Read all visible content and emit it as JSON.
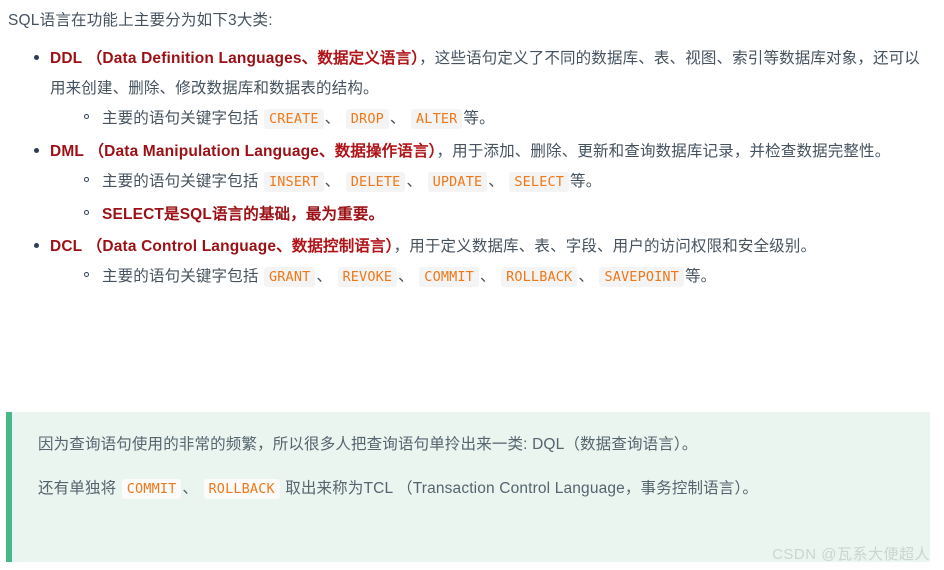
{
  "doc": {
    "intro": "SQL语言在功能上主要分为如下3大类:",
    "sections": [
      {
        "abbr": "DDL",
        "title_en": "（Data Definition Languages、",
        "title_cn": "数据定义语言）",
        "body": "，这些语句定义了不同的数据库、表、视图、索引等数据库对象，还可以用来创建、删除、修改数据库和数据表的结构。",
        "subitems": [
          {
            "type": "keywords",
            "prefix": "主要的语句关键字包括",
            "keywords": [
              "CREATE",
              "DROP",
              "ALTER"
            ],
            "separator": "、",
            "suffix": "等。"
          }
        ]
      },
      {
        "abbr": "DML",
        "title_en": "（Data Manipulation Language、",
        "title_cn": "数据操作语言）",
        "body": "，用于添加、删除、更新和查询数据库记录，并检查数据完整性。",
        "subitems": [
          {
            "type": "keywords",
            "prefix": "主要的语句关键字包括",
            "keywords": [
              "INSERT",
              "DELETE",
              "UPDATE",
              "SELECT"
            ],
            "separator": "、",
            "suffix": "等。"
          },
          {
            "type": "bold",
            "text": "SELECT是SQL语言的基础，最为重要。"
          }
        ]
      },
      {
        "abbr": "DCL",
        "title_en": "（Data Control Language、",
        "title_cn": "数据控制语言）",
        "body": "，用于定义数据库、表、字段、用户的访问权限和安全级别。",
        "subitems": [
          {
            "type": "keywords",
            "prefix": "主要的语句关键字包括",
            "keywords": [
              "GRANT",
              "REVOKE",
              "COMMIT",
              "ROLLBACK",
              "SAVEPOINT"
            ],
            "separator": "、",
            "suffix": "等。"
          }
        ]
      }
    ]
  },
  "callout": {
    "paragraph1": "因为查询语句使用的非常的频繁，所以很多人把查询语句单拎出来一类: DQL（数据查询语言）。",
    "paragraph2_pre": "还有单独将",
    "paragraph2_code1": "COMMIT",
    "paragraph2_sep": "、",
    "paragraph2_code2": "ROLLBACK",
    "paragraph2_post": "取出来称为TCL （Transaction Control Language，事务控制语言）。"
  },
  "watermark": "CSDN @瓦系大便超人",
  "colors": {
    "heading_red": "#9c1015",
    "body_text": "#46535f",
    "code_orange": "#f07818",
    "code_bg": "#f4f4f4",
    "callout_bg": "#eaf5ef",
    "callout_border": "#49b887",
    "watermark": "#c9d6cf"
  }
}
